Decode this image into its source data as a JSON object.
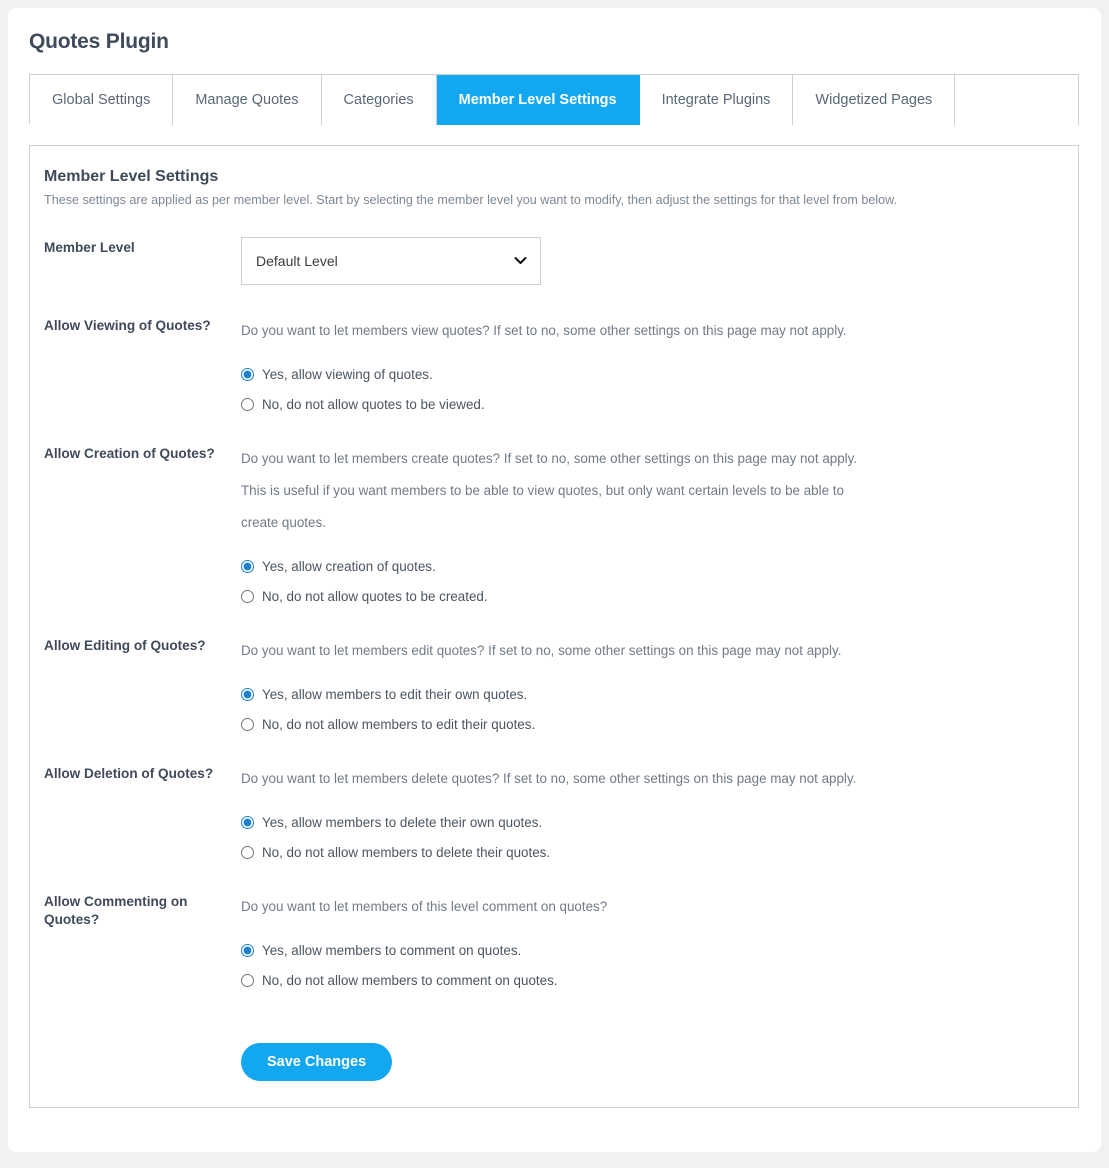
{
  "page": {
    "title": "Quotes Plugin",
    "accent_color": "#12a7ef",
    "background_color": "#f1f1f1"
  },
  "tabs": [
    {
      "label": "Global Settings",
      "active": false
    },
    {
      "label": "Manage Quotes",
      "active": false
    },
    {
      "label": "Categories",
      "active": false
    },
    {
      "label": "Member Level Settings",
      "active": true
    },
    {
      "label": "Integrate Plugins",
      "active": false
    },
    {
      "label": "Widgetized Pages",
      "active": false
    }
  ],
  "panel": {
    "title": "Member Level Settings",
    "description": "These settings are applied as per member level. Start by selecting the member level you want to modify, then adjust the settings for that level from below."
  },
  "member_level": {
    "label": "Member Level",
    "selected": "Default Level",
    "options": [
      "Default Level"
    ],
    "chevron": "⌄"
  },
  "settings": [
    {
      "label": "Allow Viewing of Quotes?",
      "description": "Do you want to let members view quotes? If set to no, some other settings on this page may not apply.",
      "options": [
        {
          "text": "Yes, allow viewing of quotes.",
          "checked": true
        },
        {
          "text": "No, do not allow quotes to be viewed.",
          "checked": false
        }
      ]
    },
    {
      "label": "Allow Creation of Quotes?",
      "description": "Do you want to let members create quotes? If set to no, some other settings on this page may not apply. This is useful if you want members to be able to view quotes, but only want certain levels to be able to create quotes.",
      "options": [
        {
          "text": "Yes, allow creation of quotes.",
          "checked": true
        },
        {
          "text": "No, do not allow quotes to be created.",
          "checked": false
        }
      ]
    },
    {
      "label": "Allow Editing of Quotes?",
      "description": "Do you want to let members edit quotes? If set to no, some other settings on this page may not apply.",
      "options": [
        {
          "text": "Yes, allow members to edit their own quotes.",
          "checked": true
        },
        {
          "text": "No, do not allow members to edit their quotes.",
          "checked": false
        }
      ]
    },
    {
      "label": "Allow Deletion of Quotes?",
      "description": "Do you want to let members delete quotes? If set to no, some other settings on this page may not apply.",
      "options": [
        {
          "text": "Yes, allow members to delete their own quotes.",
          "checked": true
        },
        {
          "text": "No, do not allow members to delete their quotes.",
          "checked": false
        }
      ]
    },
    {
      "label": "Allow Commenting on Quotes?",
      "description": "Do you want to let members of this level comment on quotes?",
      "options": [
        {
          "text": "Yes, allow members to comment on quotes.",
          "checked": true
        },
        {
          "text": "No, do not allow members to comment on quotes.",
          "checked": false
        }
      ]
    }
  ],
  "save_button": {
    "label": "Save Changes"
  }
}
